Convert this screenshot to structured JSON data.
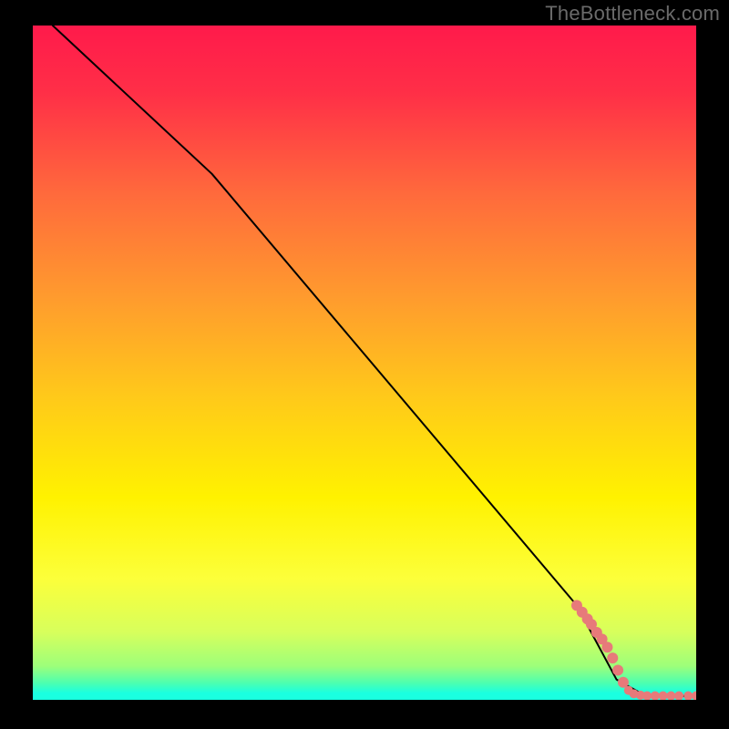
{
  "watermark": "TheBottleneck.com",
  "gradient": {
    "stops": [
      {
        "offset": 0.0,
        "color": "#ff1a4b"
      },
      {
        "offset": 0.1,
        "color": "#ff2f47"
      },
      {
        "offset": 0.25,
        "color": "#ff6a3c"
      },
      {
        "offset": 0.4,
        "color": "#ff9a2e"
      },
      {
        "offset": 0.55,
        "color": "#ffc91a"
      },
      {
        "offset": 0.7,
        "color": "#fff200"
      },
      {
        "offset": 0.82,
        "color": "#fcff3a"
      },
      {
        "offset": 0.9,
        "color": "#d7ff5c"
      },
      {
        "offset": 0.95,
        "color": "#9dff7a"
      },
      {
        "offset": 0.975,
        "color": "#4dffb0"
      },
      {
        "offset": 0.99,
        "color": "#1affe0"
      },
      {
        "offset": 1.0,
        "color": "#1affe0"
      }
    ]
  },
  "chart_data": {
    "type": "line",
    "title": "",
    "xlabel": "",
    "ylabel": "",
    "xlim": [
      0,
      100
    ],
    "ylim": [
      0,
      100
    ],
    "series": [
      {
        "name": "curve",
        "color": "#000000",
        "points": [
          {
            "x": 3,
            "y": 100
          },
          {
            "x": 27,
            "y": 78
          },
          {
            "x": 82,
            "y": 14
          },
          {
            "x": 88,
            "y": 3
          },
          {
            "x": 92,
            "y": 0.8
          },
          {
            "x": 100,
            "y": 0.5
          }
        ]
      }
    ],
    "markers": {
      "color": "#e77a7a",
      "radius_large": 6,
      "radius_small": 5,
      "points": [
        {
          "x": 82.0,
          "y": 14.0,
          "r": 6
        },
        {
          "x": 82.8,
          "y": 13.0,
          "r": 6
        },
        {
          "x": 83.6,
          "y": 12.0,
          "r": 6
        },
        {
          "x": 84.2,
          "y": 11.2,
          "r": 6
        },
        {
          "x": 85.0,
          "y": 10.0,
          "r": 6
        },
        {
          "x": 85.8,
          "y": 9.0,
          "r": 6
        },
        {
          "x": 86.6,
          "y": 7.8,
          "r": 6
        },
        {
          "x": 87.4,
          "y": 6.2,
          "r": 6
        },
        {
          "x": 88.2,
          "y": 4.4,
          "r": 6
        },
        {
          "x": 89.0,
          "y": 2.6,
          "r": 6
        },
        {
          "x": 89.8,
          "y": 1.4,
          "r": 5
        },
        {
          "x": 90.6,
          "y": 0.9,
          "r": 5
        },
        {
          "x": 91.6,
          "y": 0.7,
          "r": 5
        },
        {
          "x": 92.6,
          "y": 0.6,
          "r": 5
        },
        {
          "x": 93.8,
          "y": 0.6,
          "r": 5
        },
        {
          "x": 95.0,
          "y": 0.6,
          "r": 5
        },
        {
          "x": 96.2,
          "y": 0.6,
          "r": 5
        },
        {
          "x": 97.4,
          "y": 0.6,
          "r": 5
        },
        {
          "x": 98.8,
          "y": 0.6,
          "r": 5
        },
        {
          "x": 100.0,
          "y": 0.6,
          "r": 5
        }
      ]
    }
  }
}
